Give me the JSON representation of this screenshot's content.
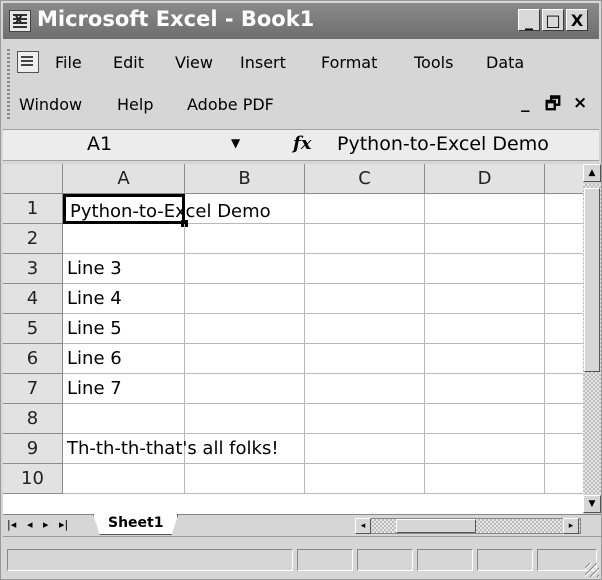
{
  "window": {
    "title": "Microsoft Excel - Book1",
    "controls": {
      "minimize": "_",
      "maximize": "□",
      "close": "X"
    }
  },
  "menubar": {
    "items": [
      "File",
      "Edit",
      "View",
      "Insert",
      "Format",
      "Tools",
      "Data",
      "Window",
      "Help",
      "Adobe PDF"
    ],
    "doc_controls": {
      "minimize": "_",
      "restore": "🗗",
      "close": "×"
    }
  },
  "formula_bar": {
    "name_box": "A1",
    "dropdown_arrow": "▼",
    "fx_label": "fx",
    "content": "Python-to-Excel Demo"
  },
  "sheet": {
    "columns": [
      "A",
      "B",
      "C",
      "D"
    ],
    "rows": [
      {
        "num": "1",
        "a": "Python-to-Excel Demo"
      },
      {
        "num": "2",
        "a": ""
      },
      {
        "num": "3",
        "a": "Line 3"
      },
      {
        "num": "4",
        "a": "Line 4"
      },
      {
        "num": "5",
        "a": "Line 5"
      },
      {
        "num": "6",
        "a": "Line 6"
      },
      {
        "num": "7",
        "a": "Line 7"
      },
      {
        "num": "8",
        "a": ""
      },
      {
        "num": "9",
        "a": "Th-th-th-that's all folks!"
      },
      {
        "num": "10",
        "a": ""
      }
    ],
    "selected_cell": "A1"
  },
  "tabs": {
    "nav": [
      "|◂",
      "◂",
      "▸",
      "▸|"
    ],
    "sheets": [
      "Sheet1"
    ]
  },
  "scroll": {
    "up": "▲",
    "down": "▼",
    "left": "◂",
    "right": "▸"
  }
}
